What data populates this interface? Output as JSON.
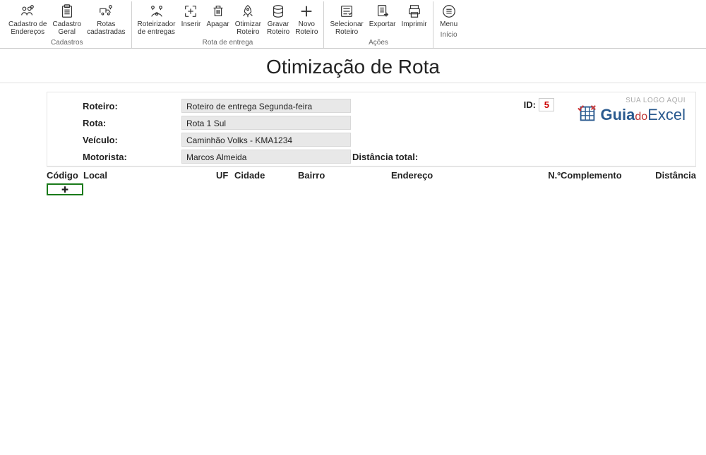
{
  "ribbon": {
    "groups": [
      {
        "title": "Cadastros",
        "items": [
          {
            "name": "cadastro-enderecos",
            "icon": "users-pin",
            "label": "Cadastro de\nEndereços"
          },
          {
            "name": "cadastro-geral",
            "icon": "clipboard",
            "label": "Cadastro\nGeral"
          },
          {
            "name": "rotas-cadastradas",
            "icon": "truck-pin",
            "label": "Rotas\ncadastradas"
          }
        ]
      },
      {
        "title": "Rota de entrega",
        "items": [
          {
            "name": "roteirizador",
            "icon": "map-pins",
            "label": "Roteirizador\nde entregas"
          },
          {
            "name": "inserir",
            "icon": "insert",
            "label": "Inserir"
          },
          {
            "name": "apagar",
            "icon": "trash",
            "label": "Apagar"
          },
          {
            "name": "otimizar",
            "icon": "rocket",
            "label": "Otimizar\nRoteiro"
          },
          {
            "name": "gravar",
            "icon": "database",
            "label": "Gravar\nRoteiro"
          },
          {
            "name": "novo",
            "icon": "plus",
            "label": "Novo\nRoteiro"
          }
        ]
      },
      {
        "title": "Ações",
        "items": [
          {
            "name": "selecionar",
            "icon": "select-list",
            "label": "Selecionar\nRoteiro"
          },
          {
            "name": "exportar",
            "icon": "export-doc",
            "label": "Exportar"
          },
          {
            "name": "imprimir",
            "icon": "printer",
            "label": "Imprimir"
          }
        ]
      },
      {
        "title": "Início",
        "items": [
          {
            "name": "menu",
            "icon": "menu",
            "label": "Menu"
          }
        ]
      }
    ]
  },
  "page_title": "Otimização de Rota",
  "form": {
    "roteiro_label": "Roteiro:",
    "roteiro_value": "Roteiro de entrega Segunda-feira",
    "rota_label": "Rota:",
    "rota_value": "Rota 1 Sul",
    "veiculo_label": "Veículo:",
    "veiculo_value": "Caminhão Volks - KMA1234",
    "motorista_label": "Motorista:",
    "motorista_value": "Marcos Almeida",
    "distancia_total_label": "Distância total:",
    "id_label": "ID:",
    "id_value": "5"
  },
  "logo": {
    "tag": "SUA LOGO AQUI",
    "guia": "Guia",
    "do": "do",
    "excel": "Excel"
  },
  "table_headers": {
    "codigo": "Código",
    "local": "Local",
    "uf": "UF",
    "cidade": "Cidade",
    "bairro": "Bairro",
    "endereco": "Endereço",
    "numero": "N.º",
    "complemento": "Complemento",
    "distancia": "Distância"
  }
}
